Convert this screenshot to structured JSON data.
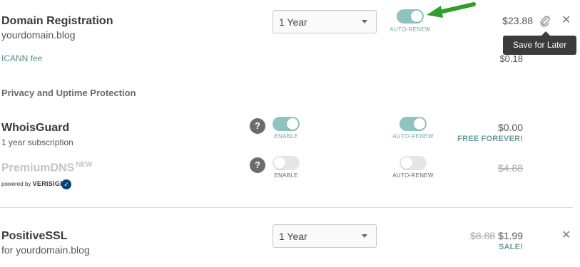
{
  "domain_registration": {
    "title": "Domain Registration",
    "domain": "yourdomain.blog",
    "period_select": "1 Year",
    "auto_renew_label": "AUTO-RENEW",
    "auto_renew_on": true,
    "price": "$23.88",
    "icann_label": "ICANN fee",
    "icann_price": "$0.18",
    "save_for_later_tooltip": "Save for Later",
    "icons": {
      "save": "paperclip-icon",
      "remove": "close-icon"
    }
  },
  "privacy_section": {
    "heading": "Privacy and Uptime Protection",
    "whoisguard": {
      "title": "WhoisGuard",
      "subtitle": "1 year subscription",
      "help": "?",
      "enable_label": "ENABLE",
      "enable_on": true,
      "auto_renew_label": "AUTO-RENEW",
      "auto_renew_on": true,
      "price": "$0.00",
      "tagline": "FREE FOREVER!"
    },
    "premiumdns": {
      "title": "PremiumDNS",
      "badge": "NEW",
      "help": "?",
      "enable_label": "ENABLE",
      "enable_on": false,
      "auto_renew_label": "AUTO-RENEW",
      "auto_renew_on": false,
      "price": "$4.88",
      "powered_by": "powered by",
      "brand": "VERISIGN"
    }
  },
  "positive_ssl": {
    "title": "PositiveSSL",
    "subtitle": "for yourdomain.blog",
    "period_select": "1 Year",
    "old_price": "$8.88",
    "price": "$1.99",
    "tagline": "SALE!",
    "icons": {
      "remove": "close-icon"
    }
  },
  "annotation": {
    "arrow_color": "#2e9e2e"
  },
  "colors": {
    "toggle_on": "#8ec3c0",
    "toggle_off": "#e6e6e6",
    "accent_text": "#6b9a9a"
  }
}
